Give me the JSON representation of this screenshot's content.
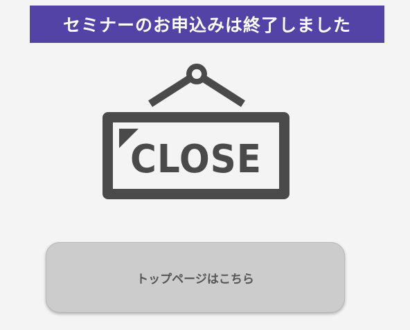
{
  "banner": {
    "text": "セミナーのお申込みは終了しました",
    "background": "#5443a6",
    "text_color": "#ffffff"
  },
  "sign": {
    "icon": "hanging-close-sign-icon",
    "text": "CLOSE",
    "color": "#4a4a4a"
  },
  "top_button": {
    "label": "トップページはこちら",
    "background": "#cccccc"
  },
  "page": {
    "background": "#f4f4f4"
  }
}
